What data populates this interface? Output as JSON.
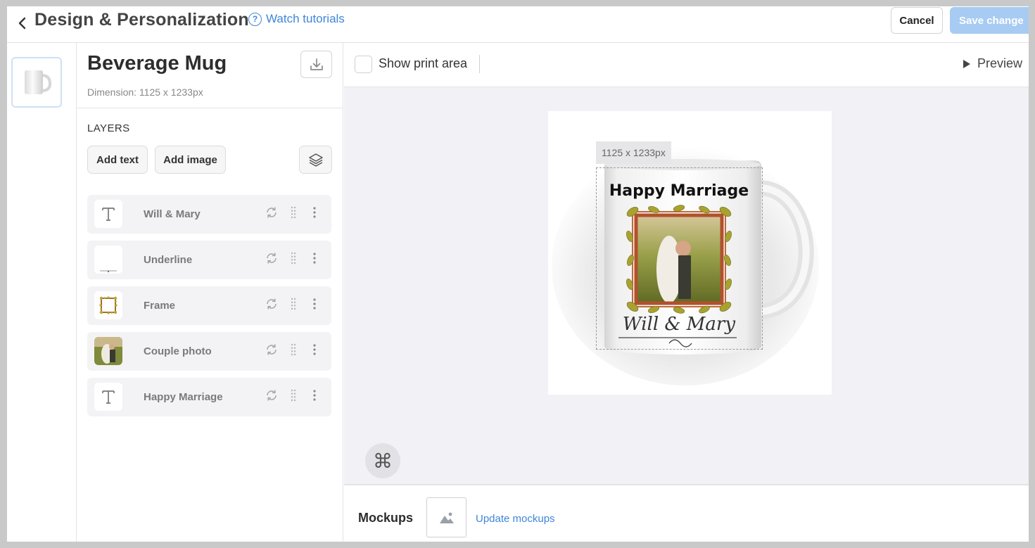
{
  "header": {
    "title": "Design & Personalization",
    "tutorials_label": "Watch tutorials",
    "cancel_label": "Cancel",
    "save_label": "Save change"
  },
  "product": {
    "name": "Beverage Mug",
    "dimension": "Dimension: 1125 x 1233px"
  },
  "layers": {
    "title": "LAYERS",
    "add_text_label": "Add text",
    "add_image_label": "Add image",
    "items": [
      {
        "name": "Will & Mary",
        "type": "text"
      },
      {
        "name": "Underline",
        "type": "image"
      },
      {
        "name": "Frame",
        "type": "image"
      },
      {
        "name": "Couple photo",
        "type": "image"
      },
      {
        "name": "Happy Marriage",
        "type": "text"
      }
    ]
  },
  "toolbar": {
    "show_print_area_label": "Show print area",
    "show_print_area_checked": false,
    "preview_label": "Preview"
  },
  "canvas": {
    "dimension_tag": "1125 x 1233px",
    "mug_headline": "Happy Marriage",
    "mug_names": "Will & Mary"
  },
  "mockups": {
    "label": "Mockups",
    "update_label": "Update mockups"
  },
  "colors": {
    "link_blue": "#3f86d8",
    "save_disabled": "#a7cbf2",
    "canvas_bg": "#f1f1f6"
  }
}
